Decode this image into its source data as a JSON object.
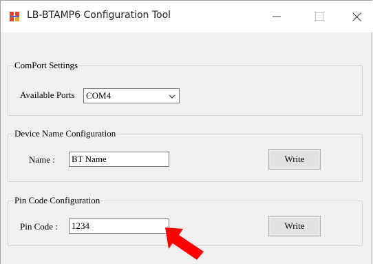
{
  "window": {
    "title": "LB-BTAMP6 Configuration Tool",
    "icons": {
      "app": "app-icon",
      "minimize": "minimize-icon",
      "maximize": "maximize-icon",
      "close": "close-icon"
    }
  },
  "comport": {
    "group_label": "ComPort Settings",
    "ports_label": "Available Ports",
    "ports_value": "COM4"
  },
  "device_name": {
    "group_label": "Device Name Configuration",
    "name_label": "Name :",
    "name_value": "BT Name",
    "write_label": "Write"
  },
  "pin_code": {
    "group_label": "Pin Code Configuration",
    "pin_label": "Pin Code :",
    "pin_value": "1234",
    "write_label": "Write"
  },
  "annotation": {
    "icon": "red-arrow-icon",
    "color": "#ff0000"
  }
}
